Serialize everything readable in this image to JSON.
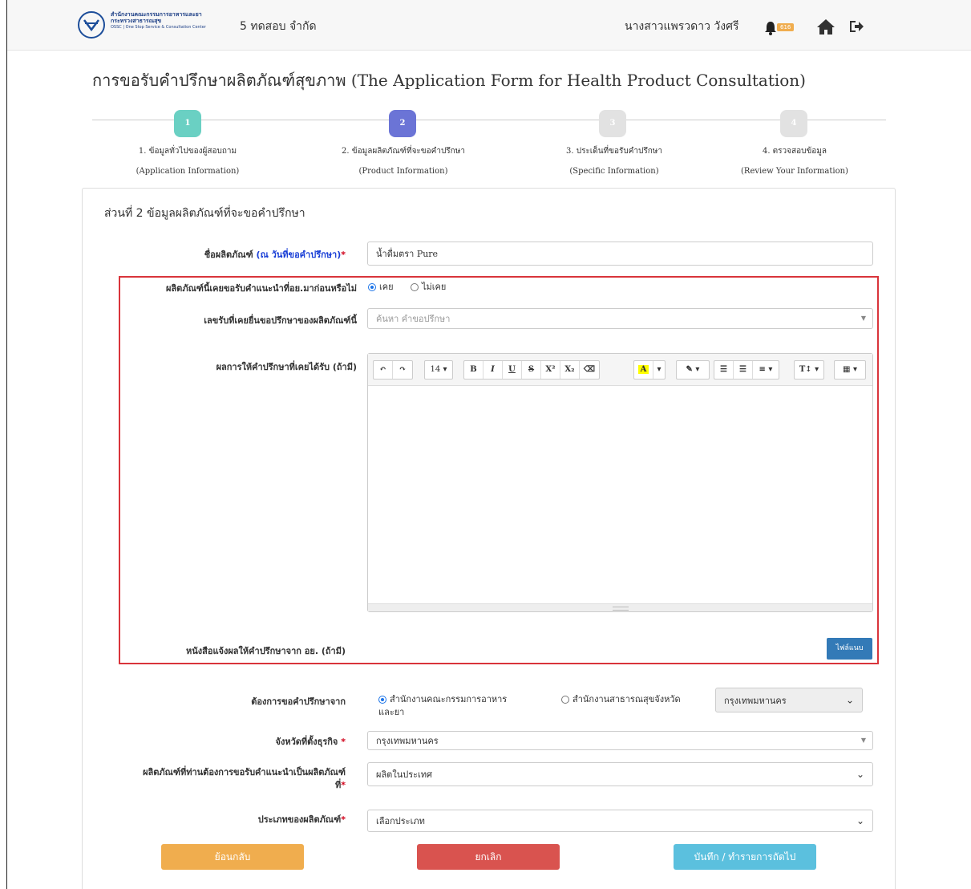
{
  "header": {
    "org_line1": "สำนักงานคณะกรรมการอาหารและยา",
    "org_line2": "กระทรวงสาธารณสุข",
    "org_line3": "OSSC | One Stop Service & Consultation Center",
    "company": "5 ทดสอบ จำกัด",
    "username": "นางสาวแพรวดาว วังศรี",
    "notification_count": "616",
    "icons": [
      "logo-icon",
      "bell-icon",
      "home-icon",
      "logout-icon"
    ]
  },
  "page": {
    "title": "การขอรับคำปรึกษาผลิตภัณฑ์สุขภาพ (The Application Form for Health Product Consultation)"
  },
  "steps": [
    {
      "number": "1",
      "label_th": "1. ข้อมูลทั่วไปของผู้สอบถาม",
      "label_en": "(Application Information)",
      "color": "#6ad0c3"
    },
    {
      "number": "2",
      "label_th": "2. ข้อมูลผลิตภัณฑ์ที่จะขอคำปรึกษา",
      "label_en": "(Product Information)",
      "color": "#6b74d6"
    },
    {
      "number": "3",
      "label_th": "3. ประเด็นที่ขอรับคำปรึกษา",
      "label_en": "(Specific Information)",
      "color": "#e2e2e2"
    },
    {
      "number": "4",
      "label_th": "4. ตรวจสอบข้อมูล",
      "label_en": "(Review Your Information)",
      "color": "#e2e2e2"
    }
  ],
  "form": {
    "section_title": "ส่วนที่ 2 ข้อมูลผลิตภัณฑ์ที่จะขอคำปรึกษา",
    "product_name_label": "ชื่อผลิตภัณฑ์",
    "product_name_label_note": "(ณ วันที่ขอคำปรึกษา)",
    "product_name_value": "น้ำดื่มตรา Pure",
    "prev_advice_label": "ผลิตภัณฑ์นี้เคยขอรับคำแนะนำที่อย.มาก่อนหรือไม่",
    "prev_advice_yes": "เคย",
    "prev_advice_no": "ไม่เคย",
    "prev_ref_label": "เลขรับที่เคยยื่นขอปรึกษาของผลิตภัณฑ์นี้",
    "prev_ref_placeholder": "ค้นหา คำขอปรึกษา",
    "prev_result_label": "ผลการให้คำปรึกษาที่เคยได้รับ (ถ้ามี)",
    "editor_font_size": "14",
    "letter_label": "หนังสือแจ้งผลให้คำปรึกษาจาก อย. (ถ้ามี)",
    "attach_label": "ไฟล์แนบ",
    "consult_from_label": "ต้องการขอคำปรึกษาจาก",
    "consult_from_fda_line1": "สำนักงานคณะกรรมการอาหาร",
    "consult_from_fda_line2": "และยา",
    "consult_from_provincial": "สำนักงานสาธารณสุขจังหวัด",
    "consult_province_value": "กรุงเทพมหานคร",
    "business_province_label": "จังหวัดที่ตั้งธุรกิจ",
    "business_province_value": "กรุงเทพมหานคร",
    "product_origin_label_line1": "ผลิตภัณฑ์ที่ท่านต้องการขอรับคำแนะนำเป็นผลิตภัณฑ์",
    "product_origin_label_line2": "ที่",
    "product_origin_value": "ผลิตในประเทศ",
    "product_type_label": "ประเภทของผลิตภัณฑ์",
    "product_type_value": "เลือกประเภท",
    "required_mark": "*"
  },
  "buttons": {
    "back": "ย้อนกลับ",
    "cancel": "ยกเลิก",
    "next": "บันทึก / ทำรายการถัดไป"
  },
  "colors": {
    "back": "#f0ad4e",
    "cancel": "#d9534f",
    "next": "#5bc0de",
    "attach": "#337ab7",
    "highlight_box": "#d9343b"
  }
}
